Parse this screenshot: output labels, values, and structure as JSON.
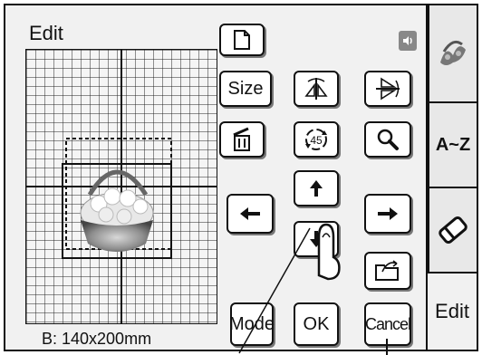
{
  "screen": {
    "title": "Edit",
    "status": "B: 140x200mm"
  },
  "toolbar": {
    "size_label": "Size",
    "rotate_label": "45",
    "mode_label": "Mode",
    "ok_label": "OK",
    "cancel_label": "Cancel"
  },
  "tabs": [
    {
      "label": "",
      "icon": "embroidery-pattern-icon"
    },
    {
      "label": "A~Z",
      "icon": "text-icon"
    },
    {
      "label": "",
      "icon": "eraser-icon"
    },
    {
      "label": "Edit",
      "icon": ""
    }
  ],
  "colors": {
    "screen_bg": "#f1f1f1",
    "line": "#111111"
  }
}
